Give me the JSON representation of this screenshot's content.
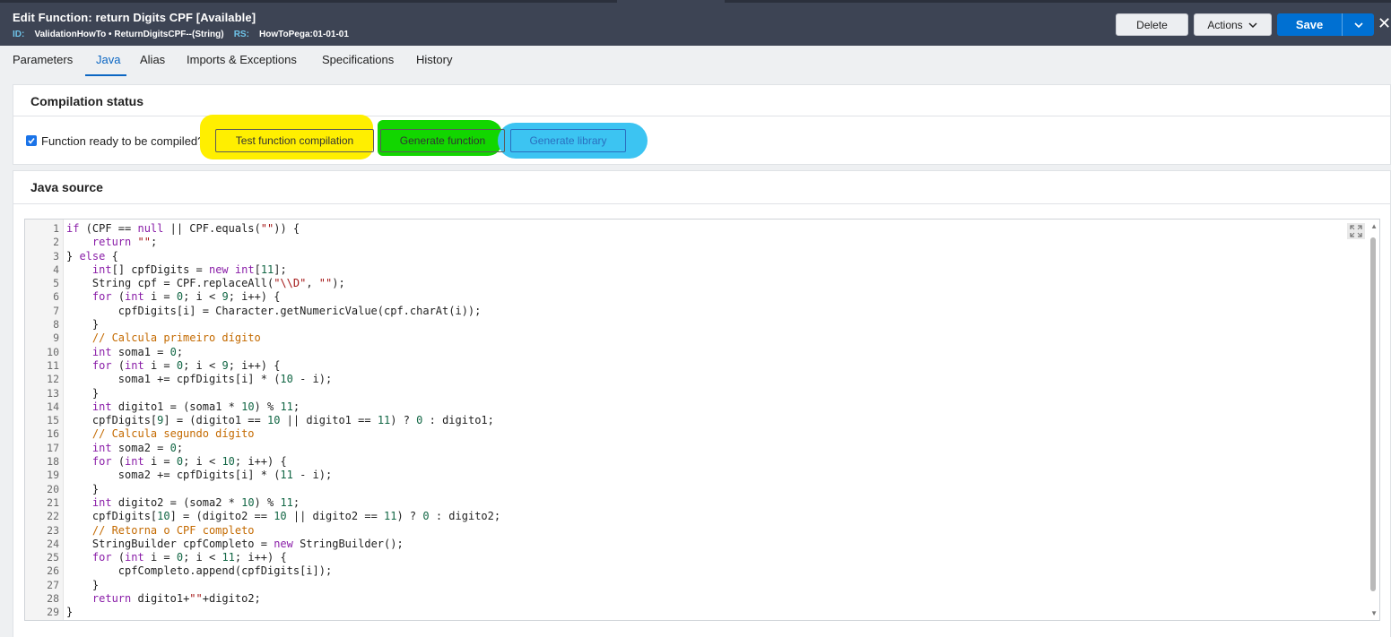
{
  "header": {
    "title": "Edit  Function: return Digits CPF [Available]",
    "id_label": "ID:",
    "id_value": "ValidationHowTo • ReturnDigitsCPF--(String)",
    "rs_label": "RS:",
    "rs_value": "HowToPega:01-01-01",
    "delete_label": "Delete",
    "actions_label": "Actions",
    "save_label": "Save",
    "close_glyph": "✕"
  },
  "tabs": [
    "Parameters",
    "Java",
    "Alias",
    "Imports & Exceptions",
    "Specifications",
    "History"
  ],
  "compilation": {
    "title": "Compilation status",
    "checkbox_label": "Function ready to be compiled?",
    "checked": true,
    "buttons": {
      "test": "Test function compilation",
      "generate_function": "Generate function",
      "generate_library": "Generate library"
    },
    "highlight_colors": {
      "test": "#ffef00",
      "generate_function": "#12d600",
      "generate_library": "#3cc4f2"
    }
  },
  "java_source": {
    "title": "Java source",
    "lines": [
      "if (CPF == null || CPF.equals(\"\")) {",
      "    return \"\";",
      "} else {",
      "    int[] cpfDigits = new int[11];",
      "    String cpf = CPF.replaceAll(\"\\\\D\", \"\");",
      "    for (int i = 0; i < 9; i++) {",
      "        cpfDigits[i] = Character.getNumericValue(cpf.charAt(i));",
      "    }",
      "    // Calcula primeiro dígito",
      "    int soma1 = 0;",
      "    for (int i = 0; i < 9; i++) {",
      "        soma1 += cpfDigits[i] * (10 - i);",
      "    }",
      "    int digito1 = (soma1 * 10) % 11;",
      "    cpfDigits[9] = (digito1 == 10 || digito1 == 11) ? 0 : digito1;",
      "    // Calcula segundo dígito",
      "    int soma2 = 0;",
      "    for (int i = 0; i < 10; i++) {",
      "        soma2 += cpfDigits[i] * (11 - i);",
      "    }",
      "    int digito2 = (soma2 * 10) % 11;",
      "    cpfDigits[10] = (digito2 == 10 || digito2 == 11) ? 0 : digito2;",
      "    // Retorna o CPF completo",
      "    StringBuilder cpfCompleto = new StringBuilder();",
      "    for (int i = 0; i < 11; i++) {",
      "        cpfCompleto.append(cpfDigits[i]);",
      "    }",
      "    return digito1+\"\"+digito2;",
      "}"
    ]
  }
}
